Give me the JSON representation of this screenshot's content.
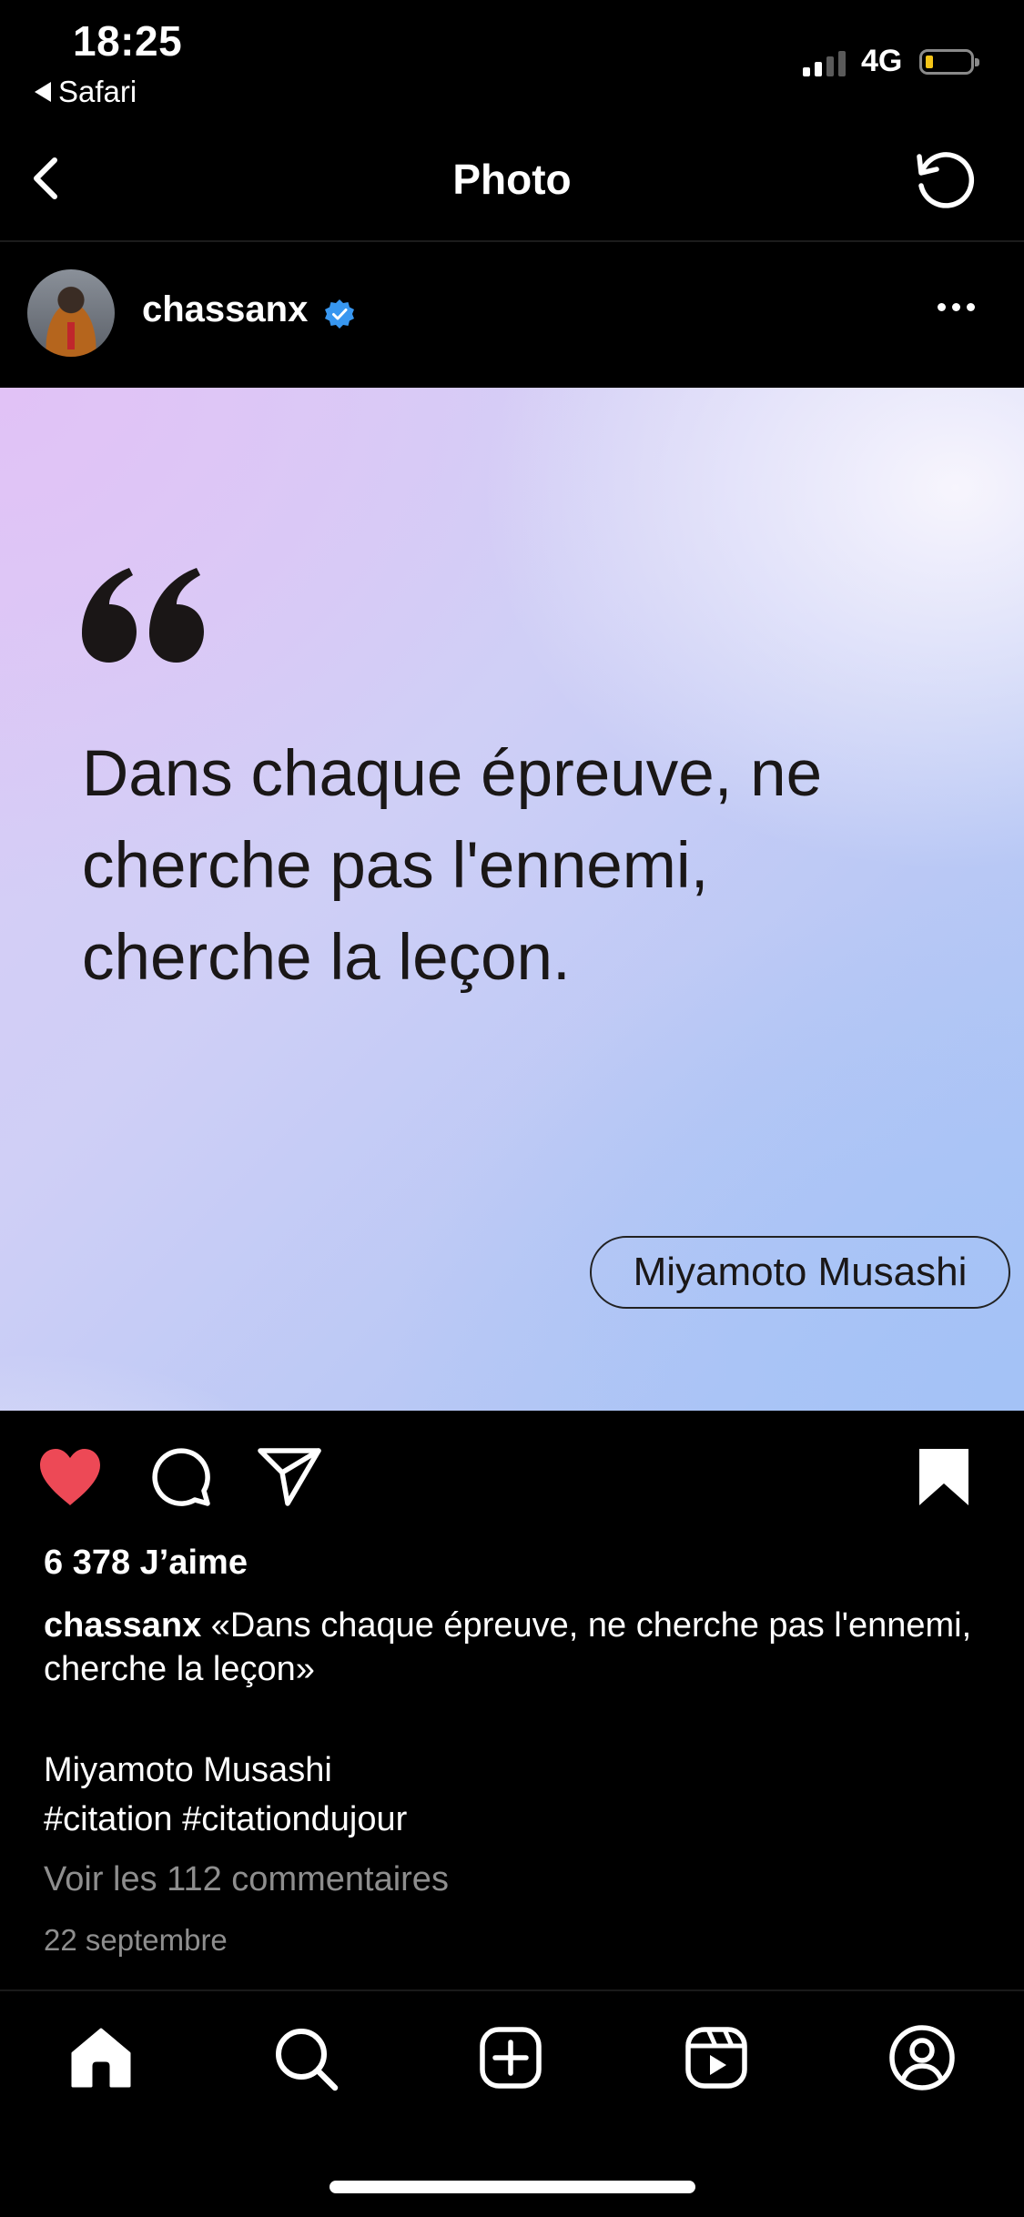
{
  "status_bar": {
    "time": "18:25",
    "back_app": "Safari",
    "network": "4G",
    "battery_color": "#f5c518"
  },
  "header": {
    "title": "Photo",
    "back_icon": "chevron-left-icon",
    "refresh_icon": "refresh-icon"
  },
  "post": {
    "username": "chassanx",
    "verified": true,
    "quote": "Dans chaque épreuve, ne cherche pas l'ennemi, cherche la leçon.",
    "author": "Miyamoto Musashi",
    "liked": true,
    "likes_text": "6 378 J’aime",
    "caption_username": "chassanx",
    "caption_text": "«Dans chaque épreuve, ne cherche pas l'ennemi, cherche la leçon»",
    "caption_author": "Miyamoto Musashi",
    "hashtags": "#citation #citationdujour",
    "comments_link": "Voir les 112 commentaires",
    "date": "22 septembre"
  },
  "colors": {
    "like_red": "#ed4956",
    "verified_blue": "#3897f0"
  },
  "tab_bar": {
    "items": [
      "home-icon",
      "search-icon",
      "new-post-icon",
      "reels-icon",
      "profile-icon"
    ]
  }
}
